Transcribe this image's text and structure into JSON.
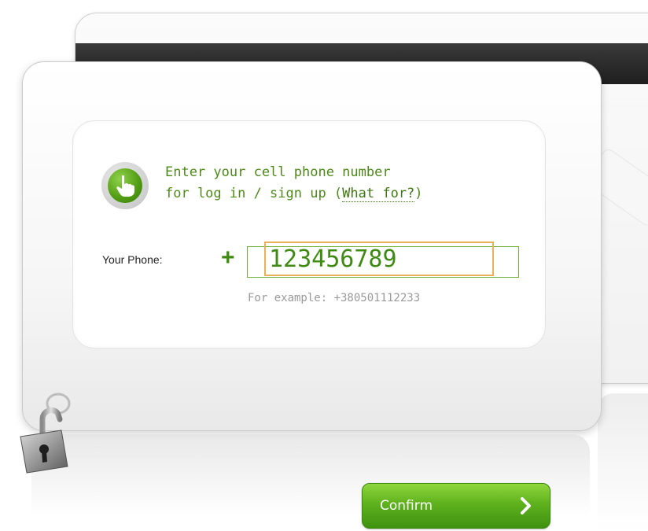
{
  "login": {
    "hint_line1": "Enter your cell phone number",
    "hint_line2_prefix": "for log in / sign up (",
    "hint_link": "What for?",
    "hint_line2_suffix": ")",
    "phone_label": "Your Phone:",
    "plus_sign": "+",
    "phone_value": "123456789",
    "example_text": "For example: +380501112233",
    "confirm_label": "Confirm"
  },
  "icons": {
    "hint": "pointing-hand-icon",
    "lock": "padlock-icon",
    "confirm_arrow": "chevron-right-icon"
  },
  "colors": {
    "accent_green": "#4d8a17",
    "button_green": "#5fb21d",
    "input_focus": "#eab05a",
    "example_gray": "#9a9a9a"
  }
}
